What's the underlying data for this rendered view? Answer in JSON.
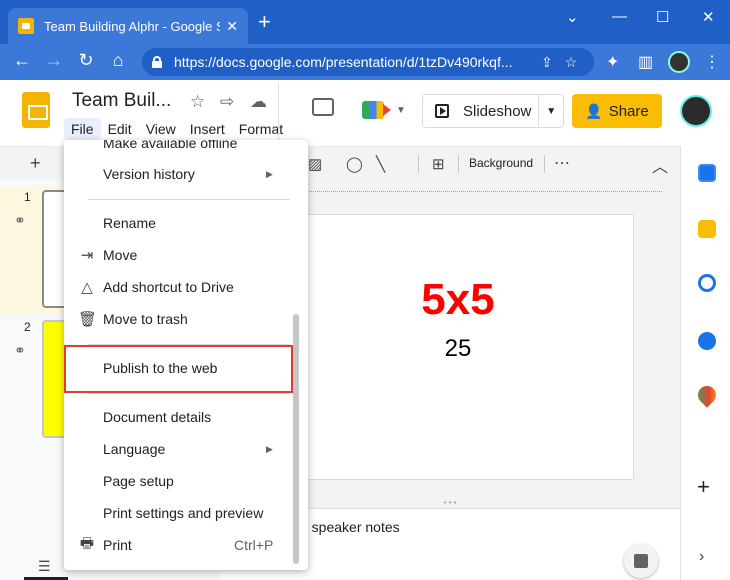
{
  "browser": {
    "tab_title": "Team Building Alphr - Google Slides",
    "tab_close": "✕",
    "new_tab": "+",
    "url": "https://docs.google.com/presentation/d/1tzDv490rkqf...",
    "window_controls": [
      "⌄",
      "—",
      "☐",
      "✕"
    ]
  },
  "app": {
    "doc_title": "Team Buil...",
    "menus": [
      "File",
      "Edit",
      "View",
      "Insert",
      "Format"
    ],
    "slideshow_label": "Slideshow",
    "share_label": "Share",
    "background_label": "Background"
  },
  "file_menu": {
    "items": {
      "make_offline": "Make available offline",
      "version_history": "Version history",
      "rename": "Rename",
      "move": "Move",
      "add_shortcut": "Add shortcut to Drive",
      "move_trash": "Move to trash",
      "publish": "Publish to the web",
      "details": "Document details",
      "language": "Language",
      "page_setup": "Page setup",
      "print_settings": "Print settings and preview",
      "print": "Print",
      "print_shortcut": "Ctrl+P"
    },
    "highlighted_item": "Publish to the web",
    "highlight_color": "#e53935"
  },
  "filmstrip": {
    "slides": [
      {
        "number": "1",
        "fill": "#ffffff",
        "selected": true
      },
      {
        "number": "2",
        "fill": "#ffff00",
        "selected": false
      }
    ]
  },
  "slide": {
    "heading": "5x5",
    "heading_color": "#ff0000",
    "subtitle": "25"
  },
  "notes": {
    "text": "d speaker notes"
  },
  "side_panel": {
    "icons": [
      "calendar-icon",
      "keep-icon",
      "tasks-icon",
      "contacts-icon",
      "maps-icon"
    ]
  },
  "colors": {
    "chrome_tab": "#1f5fc6",
    "chrome_bar": "#3c78d8",
    "share_yellow": "#fbbc04",
    "slides_yellow": "#f4b400"
  }
}
